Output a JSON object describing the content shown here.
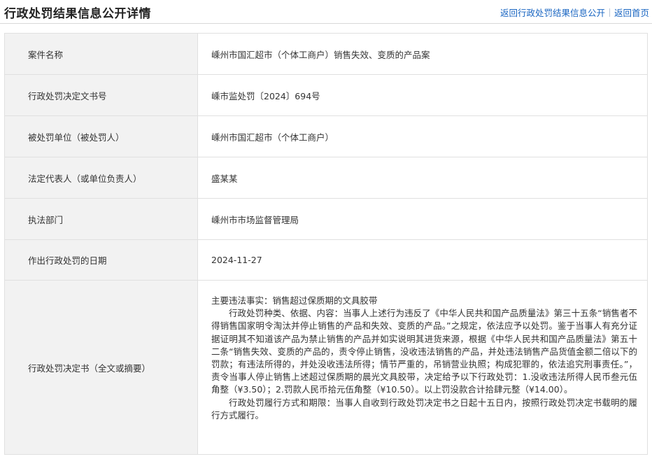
{
  "header": {
    "title": "行政处罚结果信息公开详情",
    "link_back_list": "返回行政处罚结果信息公开",
    "link_home": "返回首页"
  },
  "rows": [
    {
      "label": "案件名称",
      "value": "嵊州市国汇超市（个体工商户）销售失效、变质的产品案"
    },
    {
      "label": "行政处罚决定文书号",
      "value": "嵊市监处罚〔2024〕694号"
    },
    {
      "label": "被处罚单位（被处罚人）",
      "value": "嵊州市国汇超市（个体工商户）"
    },
    {
      "label": "法定代表人（或单位负责人）",
      "value": "盛某某"
    },
    {
      "label": "执法部门",
      "value": "嵊州市市场监督管理局"
    },
    {
      "label": "作出行政处罚的日期",
      "value": "2024-11-27"
    }
  ],
  "decision": {
    "label": "行政处罚决定书（全文或摘要）",
    "facts": "主要违法事实：销售超过保质期的文具胶带",
    "basis": "行政处罚种类、依据、内容：当事人上述行为违反了《中华人民共和国产品质量法》第三十五条“销售者不得销售国家明令淘汰并停止销售的产品和失效、变质的产品。”之规定，依法应予以处罚。鉴于当事人有充分证据证明其不知道该产品为禁止销售的产品并如实说明其进货来源，根据《中华人民共和国产品质量法》第五十二条“销售失效、变质的产品的，责令停止销售，没收违法销售的产品，并处违法销售产品货值金额二倍以下的罚款；有违法所得的，并处没收违法所得；情节严重的，吊销营业执照；构成犯罪的，依法追究刑事责任。”，责令当事人停止销售上述超过保质期的晨光文具胶带，决定给予以下行政处罚：1.没收违法所得人民币叁元伍角整（¥3.50）；2.罚款人民币拾元伍角整（¥10.50）。以上罚没款合计拾肆元整（¥14.00）。",
    "fulfillment": "行政处罚履行方式和期限：当事人自收到行政处罚决定书之日起十五日内，按照行政处罚决定书载明的履行方式履行。"
  },
  "colors": {
    "link": "#1a66c2",
    "label_bg": "#f2f2f2",
    "border": "#e0e0e0"
  }
}
